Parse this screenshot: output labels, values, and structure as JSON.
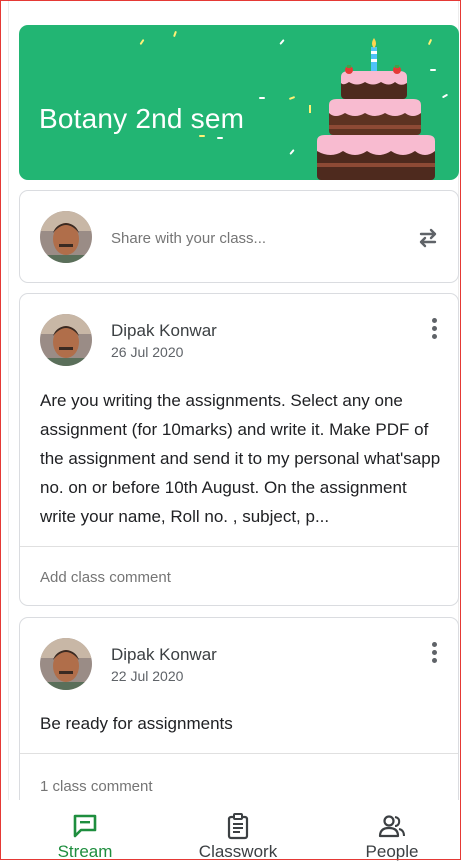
{
  "banner": {
    "title": "Botany 2nd sem"
  },
  "share": {
    "placeholder": "Share with your class..."
  },
  "posts": [
    {
      "author": "Dipak Konwar",
      "date": "26 Jul 2020",
      "body": "Are you writing the assignments. Select any one assignment  (for 10marks) and write it. Make PDF of the assignment and send it to my personal what'sapp no. on or before 10th August. On the assignment write your name, Roll no. , subject, p...",
      "comment": "Add class comment"
    },
    {
      "author": "Dipak Konwar",
      "date": "22 Jul 2020",
      "body": "Be ready for assignments",
      "comment": "1 class comment"
    }
  ],
  "nav": {
    "stream": "Stream",
    "classwork": "Classwork",
    "people": "People",
    "active": "stream"
  },
  "colors": {
    "accent": "#1e8e3e",
    "banner": "#22b573"
  }
}
